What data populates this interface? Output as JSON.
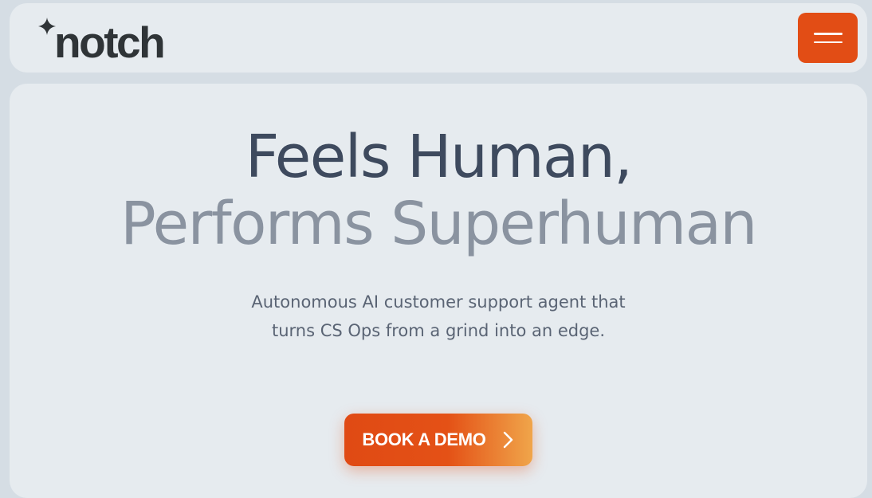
{
  "brand": {
    "name": "notch",
    "logo_icon": "sparkle-icon"
  },
  "header": {
    "menu_icon": "hamburger-menu-icon"
  },
  "hero": {
    "headline_line1": "Feels Human,",
    "headline_line2": "Performs Superhuman",
    "subheadline": "Autonomous AI customer support agent that turns CS Ops from a grind into an edge.",
    "cta_label": "BOOK A DEMO",
    "cta_icon": "chevron-right-icon"
  },
  "colors": {
    "page_background": "#d5dde4",
    "card_background": "#e6ebef",
    "accent": "#e24d15",
    "headline_dark": "#3e4a5e",
    "headline_light": "#8a93a0",
    "logo_text": "#2f3437"
  }
}
